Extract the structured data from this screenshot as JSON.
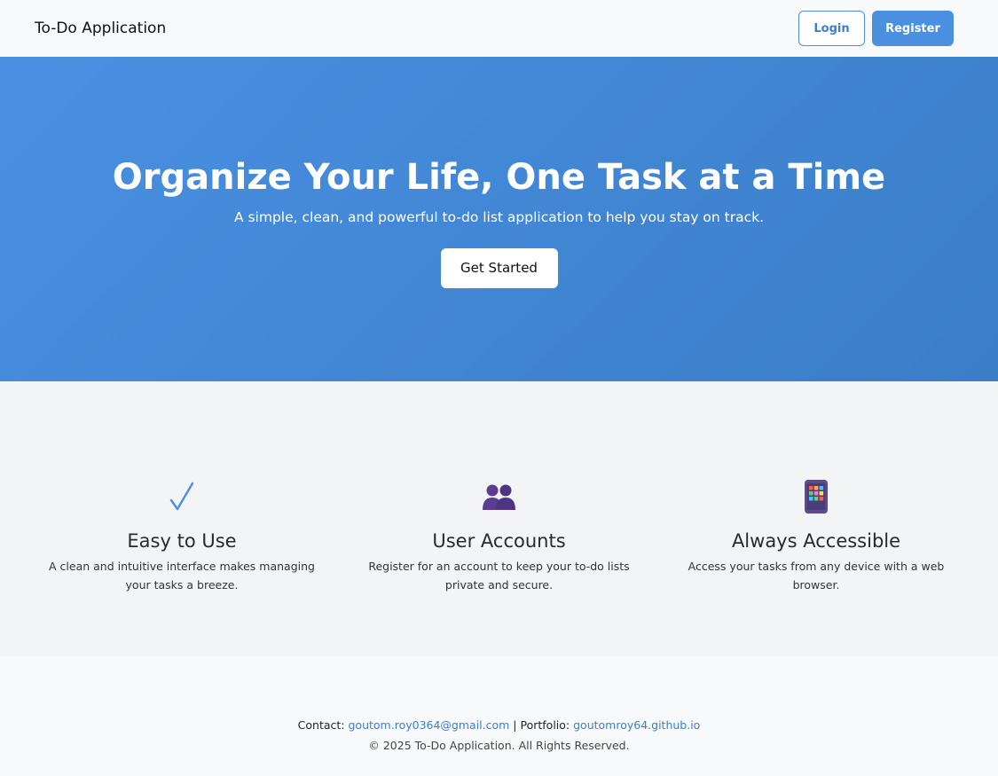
{
  "navbar": {
    "brand": "To-Do Application",
    "login_label": "Login",
    "register_label": "Register"
  },
  "hero": {
    "title": "Organize Your Life, One Task at a Time",
    "subtitle": "A simple, clean, and powerful to-do list application to help you stay on track.",
    "cta_label": "Get Started"
  },
  "features": [
    {
      "icon": "check-mark-icon",
      "title": "Easy to Use",
      "text": "A clean and intuitive interface makes managing your tasks a breeze."
    },
    {
      "icon": "users-icon",
      "title": "User Accounts",
      "text": "Register for an account to keep your to-do lists private and secure."
    },
    {
      "icon": "mobile-device-icon",
      "title": "Always Accessible",
      "text": "Access your tasks from any device with a web browser."
    }
  ],
  "footer": {
    "contact_label": "Contact:",
    "contact_email": "goutom.roy0364@gmail.com",
    "separator": "|",
    "portfolio_label": "Portfolio:",
    "portfolio_link": "goutomroy64.github.io",
    "copyright": "© 2025 To-Do Application. All Rights Reserved."
  },
  "colors": {
    "accent": "#4a8fe0",
    "hero_bg": "#4a90e2",
    "features_bg": "#f3f4f5",
    "page_bg": "#f8f9fb"
  }
}
